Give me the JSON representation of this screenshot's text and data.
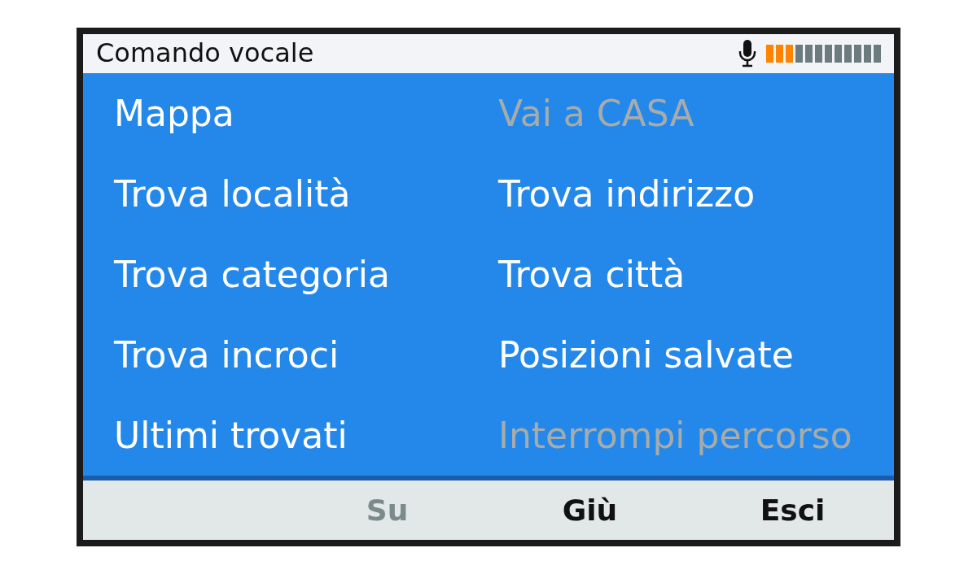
{
  "header": {
    "title": "Comando vocale",
    "mic_meter": {
      "level": 0.25
    }
  },
  "menu": [
    {
      "label": "Mappa",
      "disabled": false
    },
    {
      "label": "Vai a CASA",
      "disabled": true
    },
    {
      "label": "Trova località",
      "disabled": false
    },
    {
      "label": "Trova indirizzo",
      "disabled": false
    },
    {
      "label": "Trova categoria",
      "disabled": false
    },
    {
      "label": "Trova città",
      "disabled": false
    },
    {
      "label": "Trova incroci",
      "disabled": false
    },
    {
      "label": "Posizioni salvate",
      "disabled": false
    },
    {
      "label": "Ultimi trovati",
      "disabled": false
    },
    {
      "label": "Interrompi percorso",
      "disabled": true
    }
  ],
  "soft_keys": [
    {
      "label": "Su",
      "disabled": true
    },
    {
      "label": "Giù",
      "disabled": false
    },
    {
      "label": "Esci",
      "disabled": false
    }
  ]
}
